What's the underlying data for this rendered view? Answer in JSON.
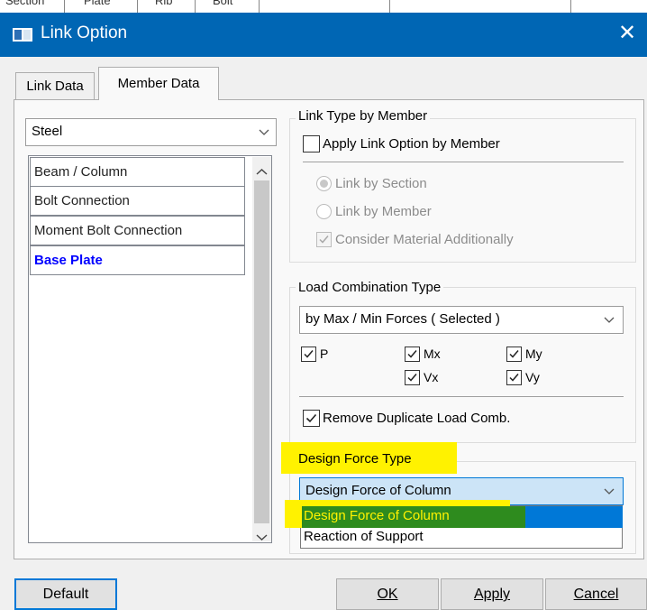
{
  "background": {
    "tabs": [
      "Section",
      "Plate",
      "Rib",
      "Bolt"
    ]
  },
  "window": {
    "title": "Link Option",
    "close_glyph": "✕"
  },
  "tabs": [
    {
      "label": "Link Data",
      "active": false
    },
    {
      "label": "Member Data",
      "active": true
    }
  ],
  "material_combo": {
    "value": "Steel"
  },
  "list": {
    "items": [
      "Beam / Column",
      "Bolt Connection",
      "Moment Bolt Connection",
      "Base Plate"
    ],
    "selected": "Base Plate",
    "selected_color": "#0000ff"
  },
  "link_type": {
    "group_label": "Link Type by Member",
    "apply_checkbox": {
      "label": "Apply Link Option by Member",
      "checked": false
    },
    "radio_section": {
      "label": "Link by Section",
      "selected": true,
      "enabled": false
    },
    "radio_member": {
      "label": "Link by Member",
      "selected": false,
      "enabled": false
    },
    "consider_material": {
      "label": "Consider Material Additionally",
      "checked": true,
      "enabled": false
    }
  },
  "load_comb": {
    "group_label": "Load Combination Type",
    "combo_value": "by Max / Min Forces ( Selected )",
    "forces": [
      {
        "label": "P",
        "checked": true
      },
      {
        "label": "Mx",
        "checked": true
      },
      {
        "label": "My",
        "checked": true
      },
      {
        "label": "Vx",
        "checked": true
      },
      {
        "label": "Vy",
        "checked": true
      }
    ],
    "remove_duplicate": {
      "label": "Remove Duplicate Load Comb.",
      "checked": true
    }
  },
  "design_force": {
    "group_label": "Design Force Type",
    "combo_value": "Design Force of Column",
    "options": [
      "Design Force of Column",
      "Reaction of Support"
    ],
    "highlighted_option": "Design Force of Column"
  },
  "buttons": {
    "default_label": "Default",
    "ok_label": "OK",
    "apply_label": "Apply",
    "cancel_label": "Cancel"
  },
  "colors": {
    "titlebar": "#0066b4",
    "highlight_yellow": "#fff200",
    "selection_blue": "#0078d7",
    "selection_green": "#2e8b1e",
    "combo_focus": "#cce4f7"
  }
}
